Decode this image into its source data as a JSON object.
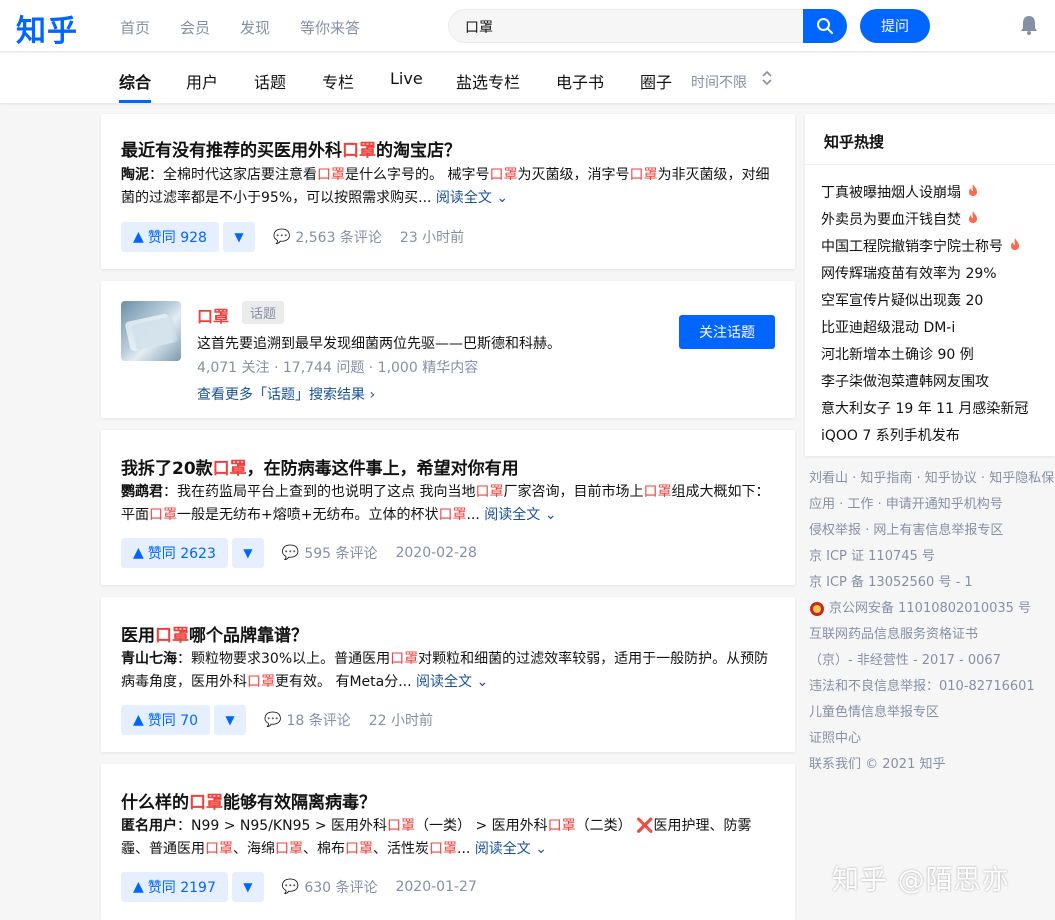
{
  "header": {
    "logo": "知乎",
    "nav": [
      "首页",
      "会员",
      "发现",
      "等你来答"
    ],
    "search_value": "口罩",
    "ask_label": "提问"
  },
  "tabs": {
    "items": [
      "综合",
      "用户",
      "话题",
      "专栏",
      "Live",
      "盐选专栏",
      "电子书",
      "圈子"
    ],
    "active": "综合",
    "time_filter": "时间不限"
  },
  "results": [
    {
      "title": [
        "最近有没有推荐的买医用外科",
        "口罩",
        "的淘宝店？"
      ],
      "author": "陶泥",
      "excerpt": [
        "：全棉时代这家店要注意看",
        "口罩",
        "是什么字号的。 械字号",
        "口罩",
        "为灭菌级，消字号",
        "口罩",
        "为非灭菌级，对细菌的过滤率都是不小于95%，可以按照需求购买..."
      ],
      "read_more": "阅读全文",
      "upvote": "赞同 928",
      "comments": "2,563 条评论",
      "time": "23 小时前"
    },
    {
      "title": [
        "我拆了20款",
        "口罩",
        "，在防病毒这件事上，希望对你有用"
      ],
      "author": "鹦鹉君",
      "excerpt": [
        "：我在药监局平台上查到的也说明了这点 我向当地",
        "口罩",
        "厂家咨询，目前市场上",
        "口罩",
        "组成大概如下：平面",
        "口罩",
        "一般是无纺布+熔喷+无纺布。立体的杯状",
        "口罩",
        "..."
      ],
      "read_more": "阅读全文",
      "upvote": "赞同 2623",
      "comments": "595 条评论",
      "time": "2020-02-28"
    },
    {
      "title": [
        "医用",
        "口罩",
        "哪个品牌靠谱？"
      ],
      "author": "青山七海",
      "excerpt": [
        "：颗粒物要求30%以上。普通医用",
        "口罩",
        "对颗粒和细菌的过滤效率较弱，适用于一般防护。从预防病毒角度，医用外科",
        "口罩",
        "更有效。 有Meta分..."
      ],
      "read_more": "阅读全文",
      "upvote": "赞同 70",
      "comments": "18 条评论",
      "time": "22 小时前"
    },
    {
      "title": [
        "什么样的",
        "口罩",
        "能够有效隔离病毒？"
      ],
      "author": "匿名用户",
      "excerpt": [
        "：N99 > N95/KN95 > 医用外科",
        "口罩",
        "（一类） > 医用外科",
        "口罩",
        "（二类） ❌医用护理、防雾霾、普通医用",
        "口罩",
        "、海绵",
        "口罩",
        "、棉布",
        "口罩",
        "、活性炭",
        "口罩",
        "..."
      ],
      "read_more": "阅读全文",
      "upvote": "赞同 2197",
      "comments": "630 条评论",
      "time": "2020-01-27"
    }
  ],
  "topic": {
    "name": "口罩",
    "badge": "话题",
    "description": "这首先要追溯到最早发现细菌两位先驱——巴斯德和科赫。",
    "stats": "4,071 关注 · 17,744 问题 · 1,000 精华内容",
    "more": "查看更多「话题」搜索结果",
    "follow_label": "关注话题"
  },
  "hot_search": {
    "title": "知乎热搜",
    "items": [
      {
        "text": "丁真被曝抽烟人设崩塌",
        "hot": true
      },
      {
        "text": "外卖员为要血汗钱自焚",
        "hot": true
      },
      {
        "text": "中国工程院撤销李宁院士称号",
        "hot": true
      },
      {
        "text": "网传辉瑞疫苗有效率为 29%",
        "hot": false
      },
      {
        "text": "空军宣传片疑似出现轰 20",
        "hot": false
      },
      {
        "text": "比亚迪超级混动 DM-i",
        "hot": false
      },
      {
        "text": "河北新增本土确诊 90 例",
        "hot": false
      },
      {
        "text": "李子柒做泡菜遭韩网友围攻",
        "hot": false
      },
      {
        "text": "意大利女子 19 年 11 月感染新冠",
        "hot": false
      },
      {
        "text": "iQOO 7 系列手机发布",
        "hot": false
      }
    ]
  },
  "footer": [
    "刘看山 · 知乎指南 · 知乎协议 · 知乎隐私保",
    "应用 · 工作 · 申请开通知乎机构号",
    "侵权举报 · 网上有害信息举报专区",
    "京 ICP 证 110745 号",
    "京 ICP 备 13052560 号 - 1",
    "京公网安备 11010802010035 号",
    "互联网药品信息服务资格证书",
    "（京）- 非经营性 - 2017 - 0067",
    "违法和不良信息举报：010-82716601",
    "儿童色情信息举报专区",
    "证照中心",
    "联系我们 © 2021 知乎"
  ],
  "watermark": "知乎 @陌思亦",
  "colors": {
    "brand": "#0066ff",
    "highlight": "#f1403c",
    "link": "#175199",
    "muted": "#8590a6",
    "hot_flame": "#ff6a4c"
  }
}
